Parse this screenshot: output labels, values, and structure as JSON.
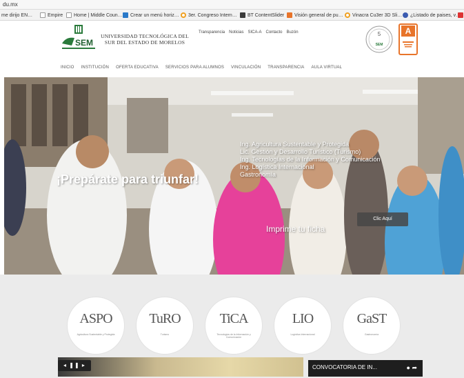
{
  "browser": {
    "url": "du.mx",
    "bookmarks": [
      {
        "label": "me dirijo EN…",
        "color": "#9b9b9b"
      },
      {
        "label": "Empire",
        "color": "#c8c8c8"
      },
      {
        "label": "Home | Middle Coun…",
        "color": "#c8c8c8"
      },
      {
        "label": "Crear un menú horiz…",
        "color": "#2a79c9"
      },
      {
        "label": "3er. Congreso Intern…",
        "color": "#f0a020"
      },
      {
        "label": "BT ContentSlider",
        "color": "#3a3a3a"
      },
      {
        "label": "Visión general de pu…",
        "color": "#e8742a"
      },
      {
        "label": "Vinacra Cu3er 3D Sli…",
        "color": "#f0a020"
      },
      {
        "label": "¿Listado de paises, v…",
        "color": "#3b5bb0"
      }
    ]
  },
  "header": {
    "university_line1": "UNIVERSIDAD TECNOLÓGICA DEL",
    "university_line2": "SUR DEL ESTADO DE MORELOS",
    "logo_text": "SEM",
    "top_links": [
      "Transparencia",
      "Noticias",
      "SICA-A",
      "Contacto",
      "Buzón"
    ],
    "badge_number": "5",
    "badge_A": "A",
    "nav": [
      "INICIO",
      "INSTITUCIÓN",
      "OFERTA EDUCATIVA",
      "SERVICIOS PARA ALUMNOS",
      "VINCULACIÓN",
      "TRANSPARENCIA",
      "AULA VIRTUAL"
    ]
  },
  "hero": {
    "title": "¡Prepárate para triunfar!",
    "careers": [
      "Ing. Agricultura Sustentable y Protegida",
      "Lic. Gestión y Desarrollo Turístico (Turismo)",
      "Ing. Tecnologías de la Información y Comunicación",
      "Ing. Logística Internacional",
      "Gastronomía"
    ],
    "imprime": "Imprime tu ficha",
    "cta": "Clic Aquí"
  },
  "programs": [
    {
      "mark": "ASPO",
      "caption": "Agricultura Sustentable y Protegida",
      "accent": "#4f9f3a"
    },
    {
      "mark": "TuRO",
      "caption": "Turismo",
      "accent": "#4f9f3a"
    },
    {
      "mark": "TiCA",
      "caption": "Tecnologías de la Información y Comunicación",
      "accent": "#4f9f3a"
    },
    {
      "mark": "LIO",
      "caption": "Logística Internacional",
      "accent": "#3a7fb5"
    },
    {
      "mark": "GaST",
      "caption": "Gastronomía",
      "accent": "#4f9f3a"
    }
  ],
  "footer": {
    "slider_controls": "◂ ❚❚ ▸",
    "convocatoria": "CONVOCATORIA DE IN..."
  }
}
